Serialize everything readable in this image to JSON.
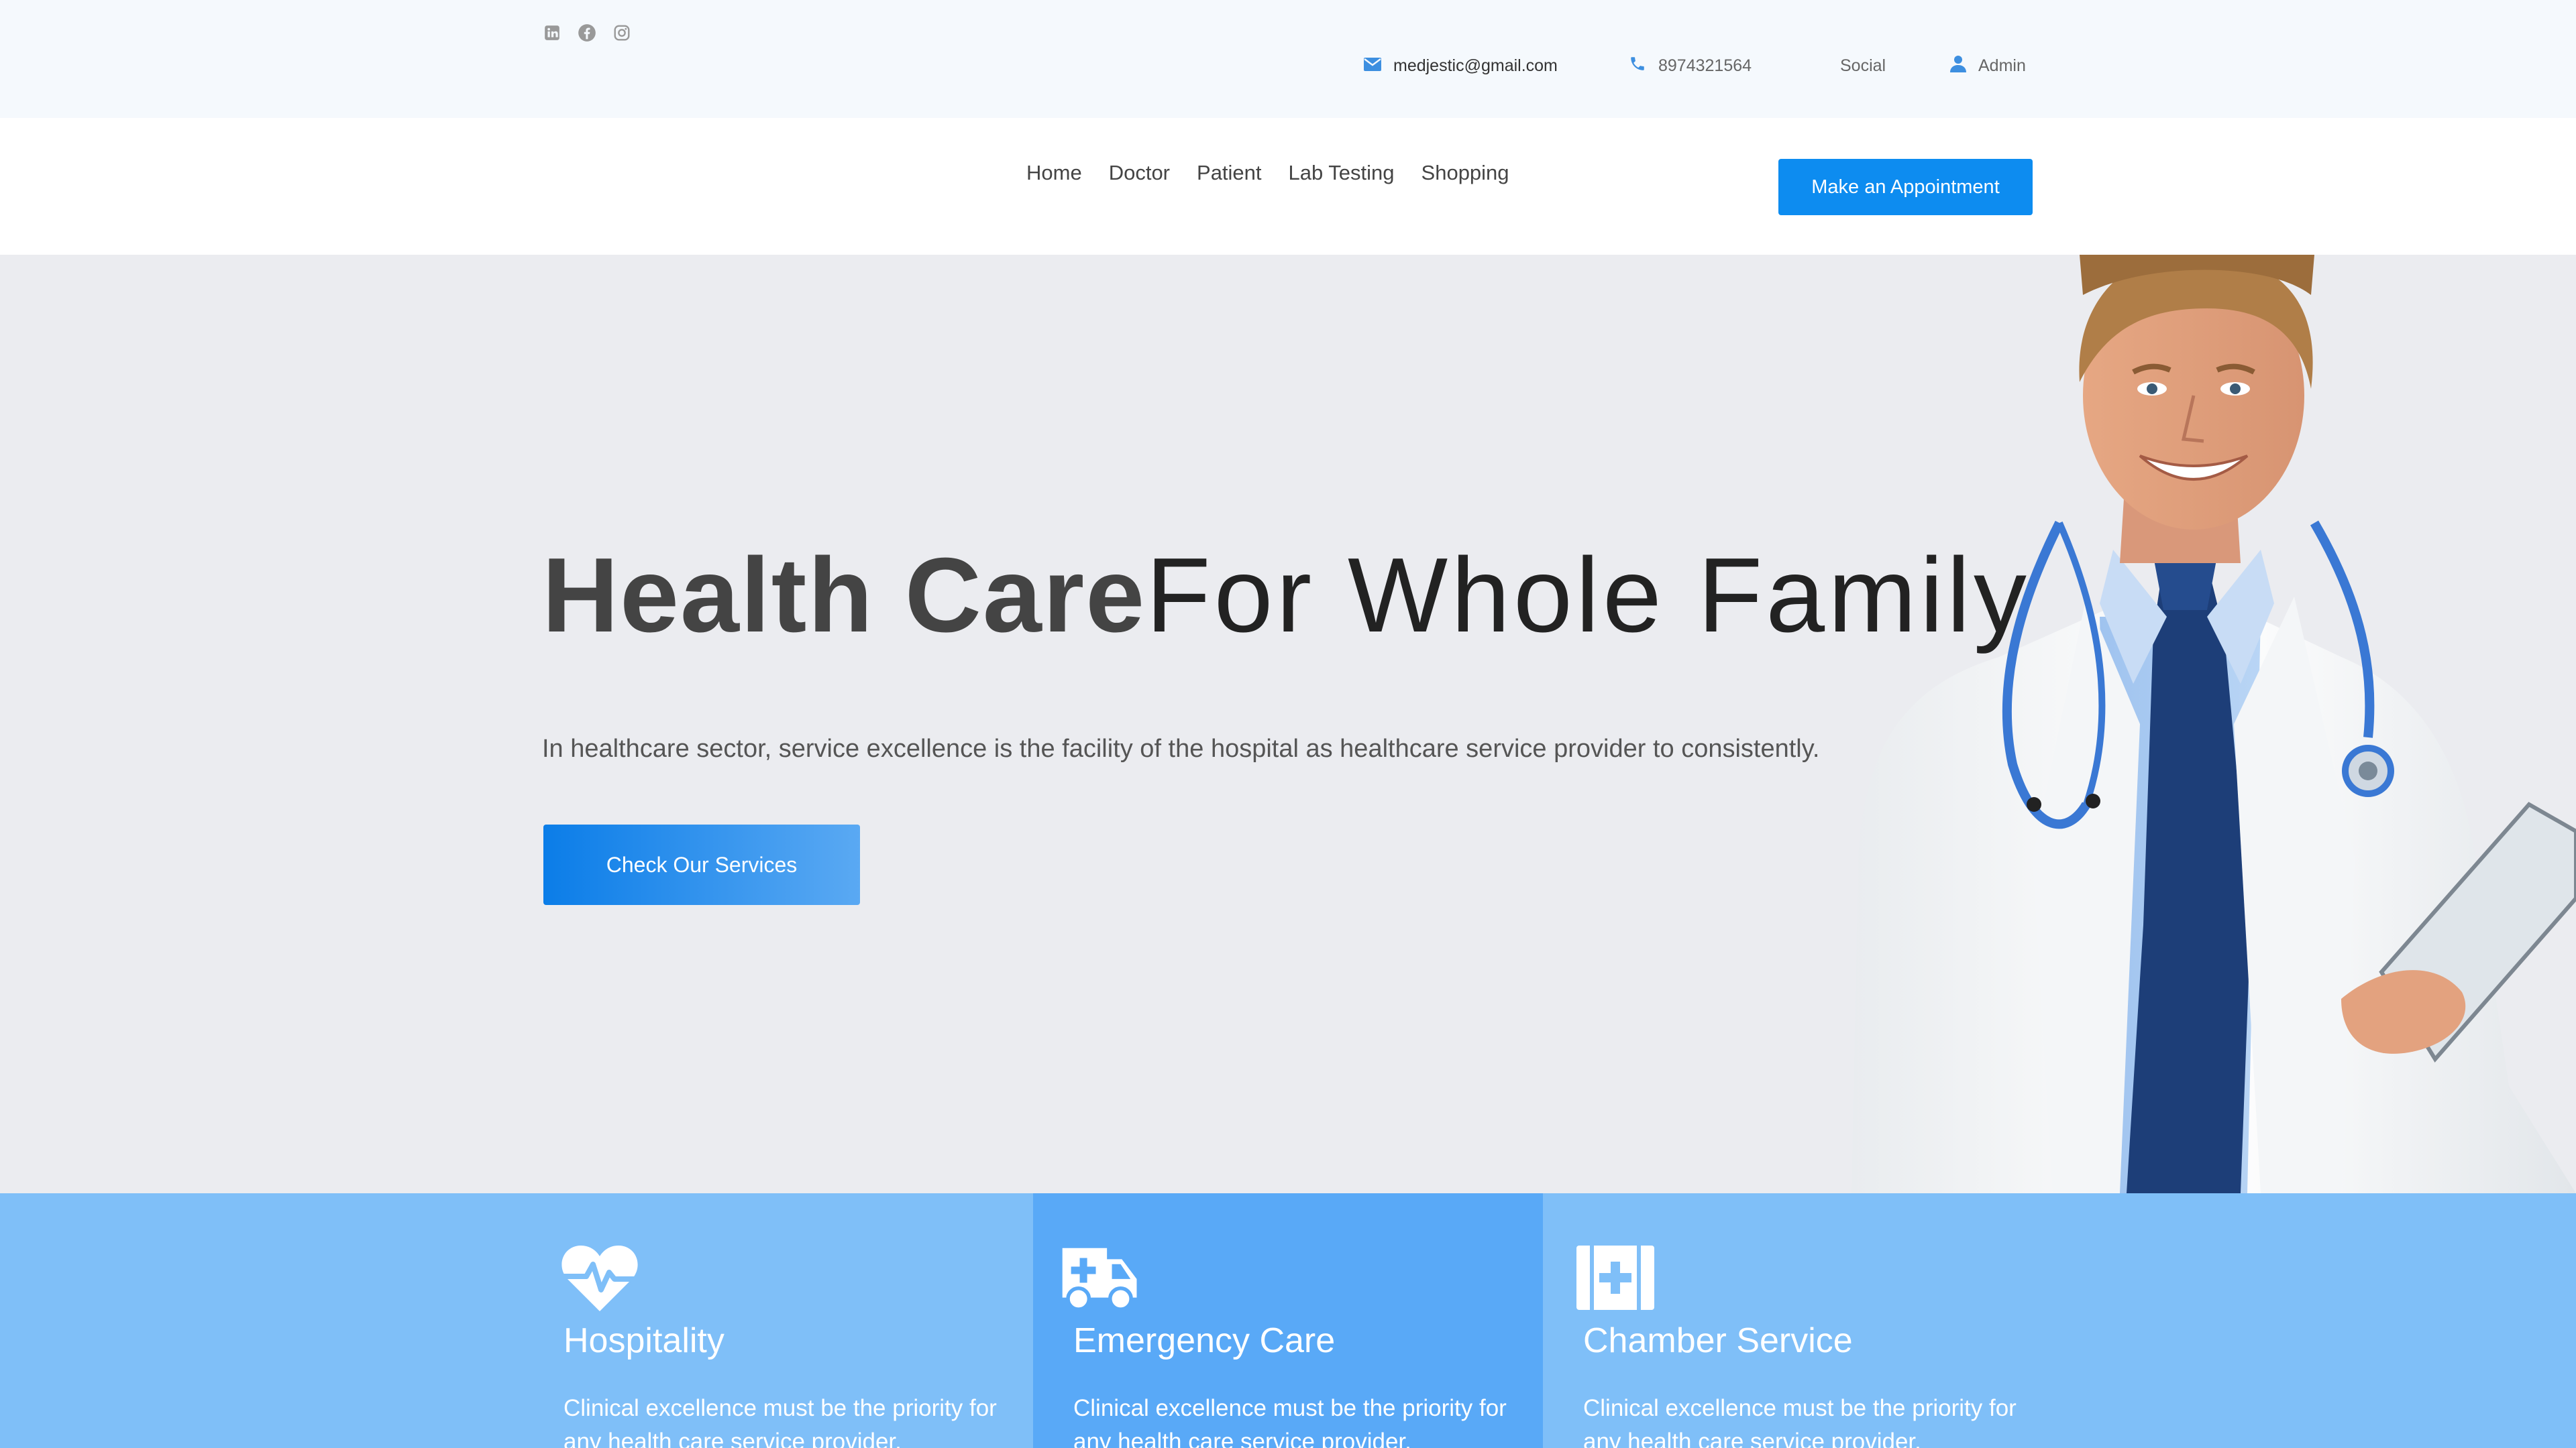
{
  "topbar": {
    "social_icons": [
      "linkedin-icon",
      "facebook-icon",
      "instagram-icon"
    ],
    "email": "medjestic@gmail.com",
    "phone": "8974321564",
    "social_label": "Social",
    "admin_label": "Admin"
  },
  "nav": {
    "items": [
      "Home",
      "Doctor",
      "Patient",
      "Lab Testing",
      "Shopping"
    ],
    "cta": "Make an Appointment"
  },
  "hero": {
    "title_bold": "Health Care",
    "title_light": "For Whole Family",
    "subtitle": "In healthcare sector, service excellence is the facility of the hospital as healthcare service provider to consistently.",
    "button": "Check Our Services"
  },
  "features": [
    {
      "icon": "heartbeat-icon",
      "title": "Hospitality",
      "text": "Clinical excellence must be the priority for any health care service provider."
    },
    {
      "icon": "ambulance-icon",
      "title": "Emergency Care",
      "text": "Clinical excellence must be the priority for any health care service provider."
    },
    {
      "icon": "medical-kit-icon",
      "title": "Chamber Service",
      "text": "Clinical excellence must be the priority for any health care service provider."
    }
  ],
  "colors": {
    "accent": "#0d8cf0",
    "topbar_bg": "#f5f9fd",
    "hero_bg": "#ebecf0",
    "feature_bg": "#7fbff8",
    "feature_highlight": "#59a9f7"
  }
}
